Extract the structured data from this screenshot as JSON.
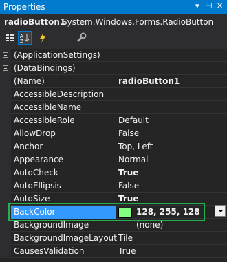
{
  "window": {
    "title": "Properties",
    "pin_icon": "pin-icon",
    "close_icon": "close-icon"
  },
  "object": {
    "name": "radioButton1",
    "type": "System.Windows.Forms.RadioButton"
  },
  "toolbar": {
    "items": [
      {
        "name": "categorized-icon"
      },
      {
        "name": "alphabetical-icon"
      },
      {
        "name": "events-lightning-icon"
      },
      {
        "name": "property-pages-wrench-icon"
      }
    ]
  },
  "properties": [
    {
      "name": "(ApplicationSettings)",
      "value": ""
    },
    {
      "name": "(DataBindings)",
      "value": ""
    },
    {
      "name": "(Name)",
      "value": "radioButton1"
    },
    {
      "name": "AccessibleDescription",
      "value": ""
    },
    {
      "name": "AccessibleName",
      "value": ""
    },
    {
      "name": "AccessibleRole",
      "value": "Default"
    },
    {
      "name": "AllowDrop",
      "value": "False"
    },
    {
      "name": "Anchor",
      "value": "Top, Left"
    },
    {
      "name": "Appearance",
      "value": "Normal"
    },
    {
      "name": "AutoCheck",
      "value": "True"
    },
    {
      "name": "AutoEllipsis",
      "value": "False"
    },
    {
      "name": "AutoSize",
      "value": "True"
    },
    {
      "name": "BackColor",
      "value": "128, 255, 128",
      "swatch_color": "#80ff80"
    },
    {
      "name": "BackgroundImage",
      "value": "(none)"
    },
    {
      "name": "BackgroundImageLayout",
      "value": "Tile"
    },
    {
      "name": "CausesValidation",
      "value": "True"
    }
  ],
  "colors": {
    "accent": "#007acc",
    "selection": "#3399ff",
    "highlight_box": "#22b14c"
  }
}
